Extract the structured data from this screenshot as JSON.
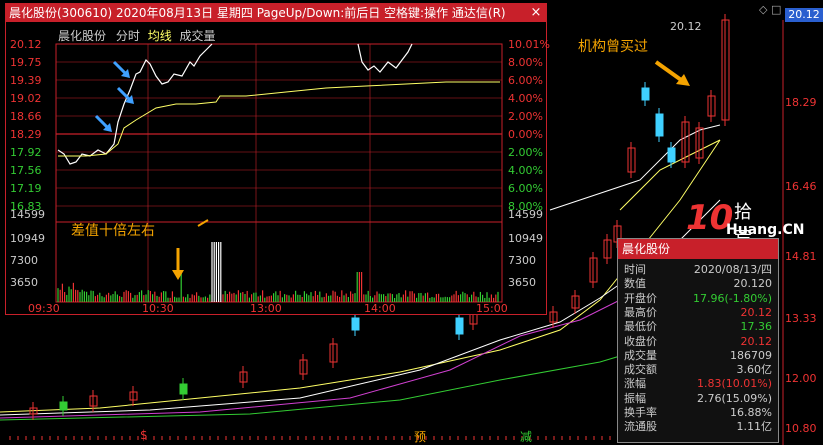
{
  "popup": {
    "title": "晨化股份(300610) 2020年08月13日 星期四 PageUp/Down:前后日 空格键:操作 通达信(R)",
    "close": "×",
    "header": {
      "stock": "晨化股份",
      "mode": "分时",
      "avg": "均线",
      "vol": "成交量"
    },
    "price_axis": [
      "20.12",
      "19.75",
      "19.39",
      "19.02",
      "18.66",
      "18.29",
      "17.92",
      "17.56",
      "17.19",
      "16.83"
    ],
    "pct_axis": [
      "10.01%",
      "8.00%",
      "6.00%",
      "4.00%",
      "2.00%",
      "0.00%",
      "2.00%",
      "4.00%",
      "6.00%",
      "8.00%"
    ],
    "vol_axis": [
      "14599",
      "10949",
      "7300",
      "3650"
    ],
    "time_axis": [
      "09:30",
      "10:30",
      "13:00",
      "14:00",
      "15:00"
    ],
    "annotation": "差值十倍左右",
    "colors": {
      "up": "#e33",
      "down": "#3c3",
      "price_line": "#ffffff",
      "avg_line": "#ffff66",
      "border": "#c8202a"
    }
  },
  "main": {
    "annotation": "机构曾买过",
    "high_label": "20.12",
    "current_badge": "20.12",
    "price_axis": [
      "18.29",
      "16.46",
      "14.81",
      "13.33",
      "12.00",
      "10.80"
    ],
    "markers": [
      "$",
      "预",
      "减"
    ]
  },
  "info": {
    "title": "晨化股份",
    "rows": [
      {
        "k": "时间",
        "v": "2020/08/13/四",
        "c": "#ccc"
      },
      {
        "k": "数值",
        "v": "20.120",
        "c": "#ccc"
      },
      {
        "k": "开盘价",
        "v": "17.96(-1.80%)",
        "c": "#3c3"
      },
      {
        "k": "最高价",
        "v": "20.12",
        "c": "#e33"
      },
      {
        "k": "最低价",
        "v": "17.36",
        "c": "#3c3"
      },
      {
        "k": "收盘价",
        "v": "20.12",
        "c": "#e33"
      },
      {
        "k": "成交量",
        "v": "186709",
        "c": "#ccc"
      },
      {
        "k": "成交额",
        "v": "3.60亿",
        "c": "#ccc"
      },
      {
        "k": "涨幅",
        "v": "1.83(10.01%)",
        "c": "#e33"
      },
      {
        "k": "振幅",
        "v": "2.76(15.09%)",
        "c": "#ccc"
      },
      {
        "k": "换手率",
        "v": "16.88%",
        "c": "#ccc"
      },
      {
        "k": "流通股",
        "v": "1.11亿",
        "c": "#ccc"
      }
    ]
  },
  "watermark": {
    "num": "10",
    "cn": "拾荒网",
    "en": "Huang.CN"
  }
}
